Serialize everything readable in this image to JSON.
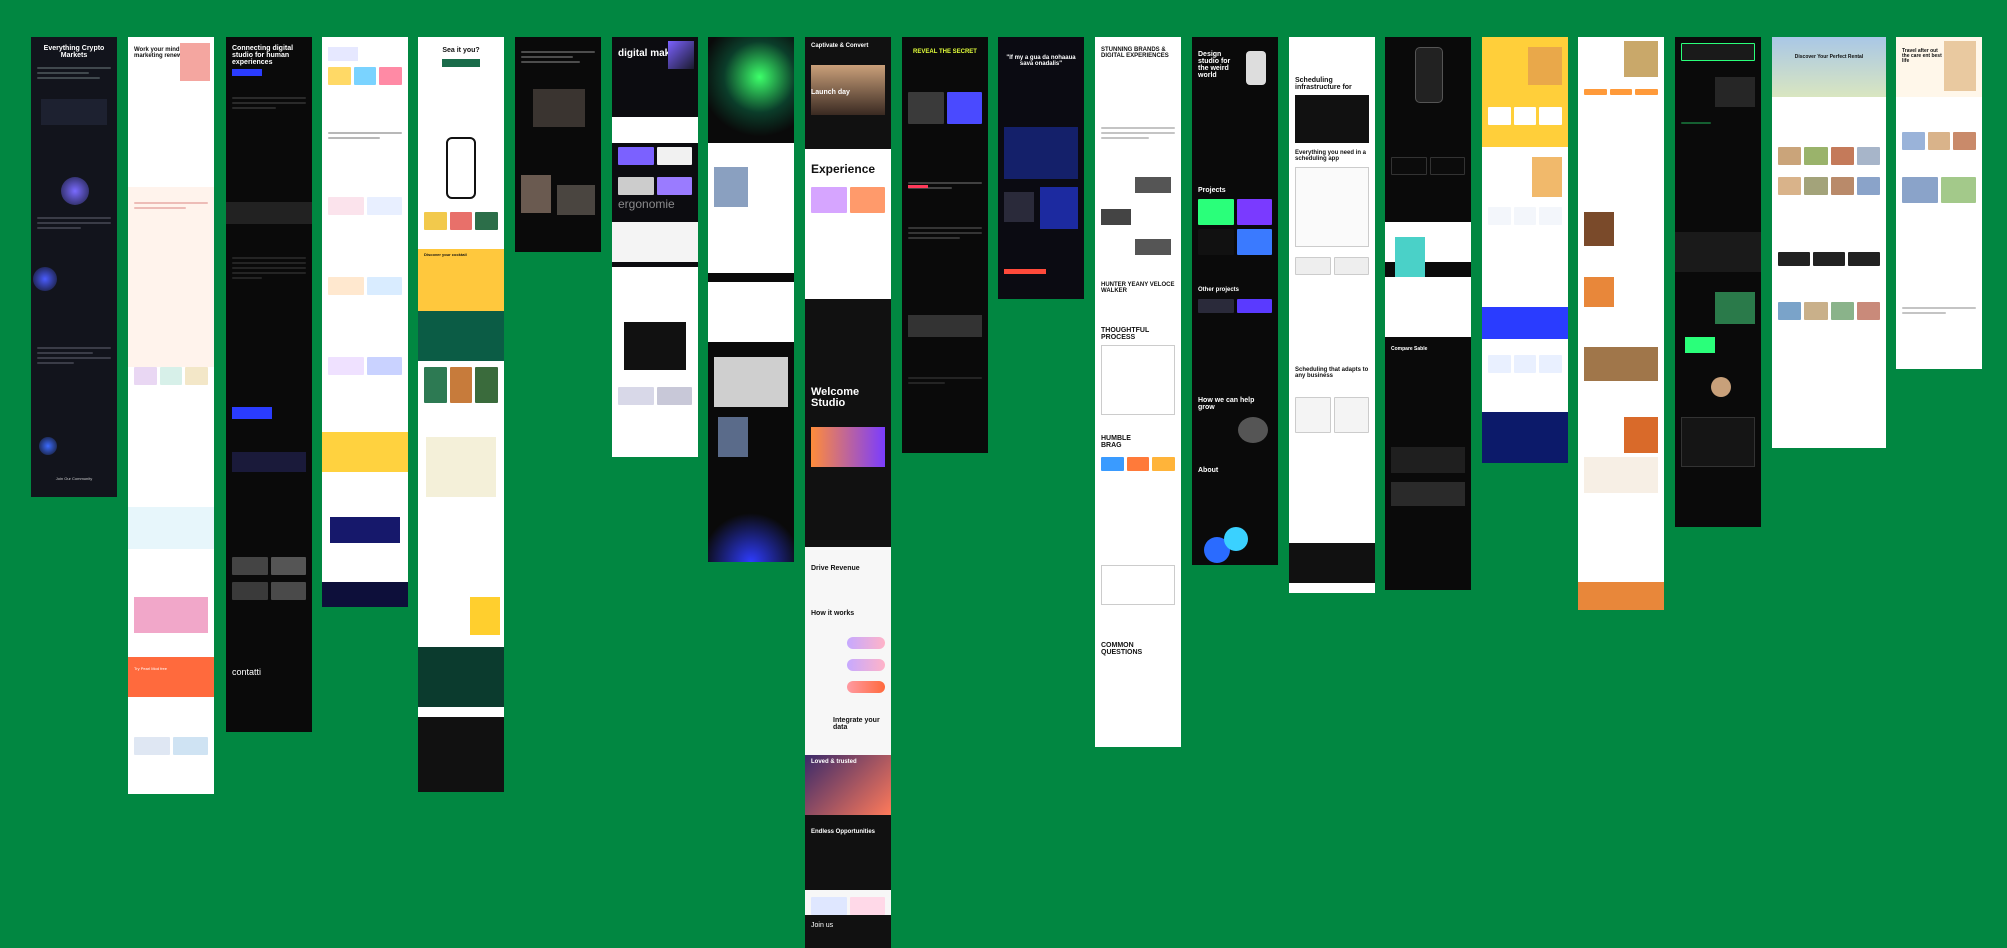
{
  "board": {
    "background": "#018741"
  },
  "thumbnails": [
    {
      "id": "s1",
      "title": "Everything Crypto Markets",
      "footer": "Join Our Community"
    },
    {
      "id": "s2",
      "title": "Work your mind into marketing renewal",
      "footer": "Try Pearl Mod free"
    },
    {
      "id": "s3",
      "title": "Connecting digital studio for human experiences",
      "footer": "contatti"
    },
    {
      "id": "s4",
      "title": "",
      "footer": ""
    },
    {
      "id": "s5",
      "title": "Sea it you?",
      "footer": "Discover your cocktail"
    },
    {
      "id": "s6",
      "title": "",
      "footer": ""
    },
    {
      "id": "s7",
      "title": "digital makers",
      "footer": "ergonomie"
    },
    {
      "id": "s8",
      "title": "",
      "footer": ""
    },
    {
      "id": "s9",
      "title": "Captivate & Convert",
      "headline2": "Launch day",
      "headline3": "Experience",
      "headline4": "Welcome Studio",
      "headline5": "Drive Revenue",
      "headline6": "How it works",
      "headline7": "Integrate your data",
      "headline8": "Loved & trusted",
      "headline9": "Endless Opportunities",
      "footer": "Join us"
    },
    {
      "id": "s10",
      "title": "REVEAL THE SECRET",
      "footer": ""
    },
    {
      "id": "s11",
      "title": "\"If my a gua da nohaaua sava onadalis\"",
      "footer": ""
    },
    {
      "id": "s12",
      "title": "STUNNING BRANDS & DIGITAL EXPERIENCES",
      "headline2": "HUNTER YEANY VELOCE WALKER",
      "headline3": "THOUGHTFUL PROCESS",
      "headline4": "HUMBLE BRAG",
      "footer": "COMMON QUESTIONS"
    },
    {
      "id": "s13",
      "title": "Design studio for the weird world",
      "headline2": "Projects",
      "headline3": "Other projects",
      "headline4": "How we can help grow",
      "footer": "About"
    },
    {
      "id": "s14",
      "title": "Scheduling infrastructure for",
      "headline2": "Everything you need in a scheduling app",
      "headline3": "Scheduling that adapts to any business",
      "footer": ""
    },
    {
      "id": "s15",
      "title": "",
      "headline2": "Compare Sable",
      "footer": ""
    },
    {
      "id": "s16",
      "title": "",
      "footer": ""
    },
    {
      "id": "s17",
      "title": "",
      "footer": ""
    },
    {
      "id": "s18",
      "title": "",
      "footer": ""
    },
    {
      "id": "s19",
      "title": "Discover Your Perfect Rental",
      "footer": ""
    },
    {
      "id": "s20",
      "title": "Travel after out the care ent best life",
      "footer": ""
    }
  ]
}
